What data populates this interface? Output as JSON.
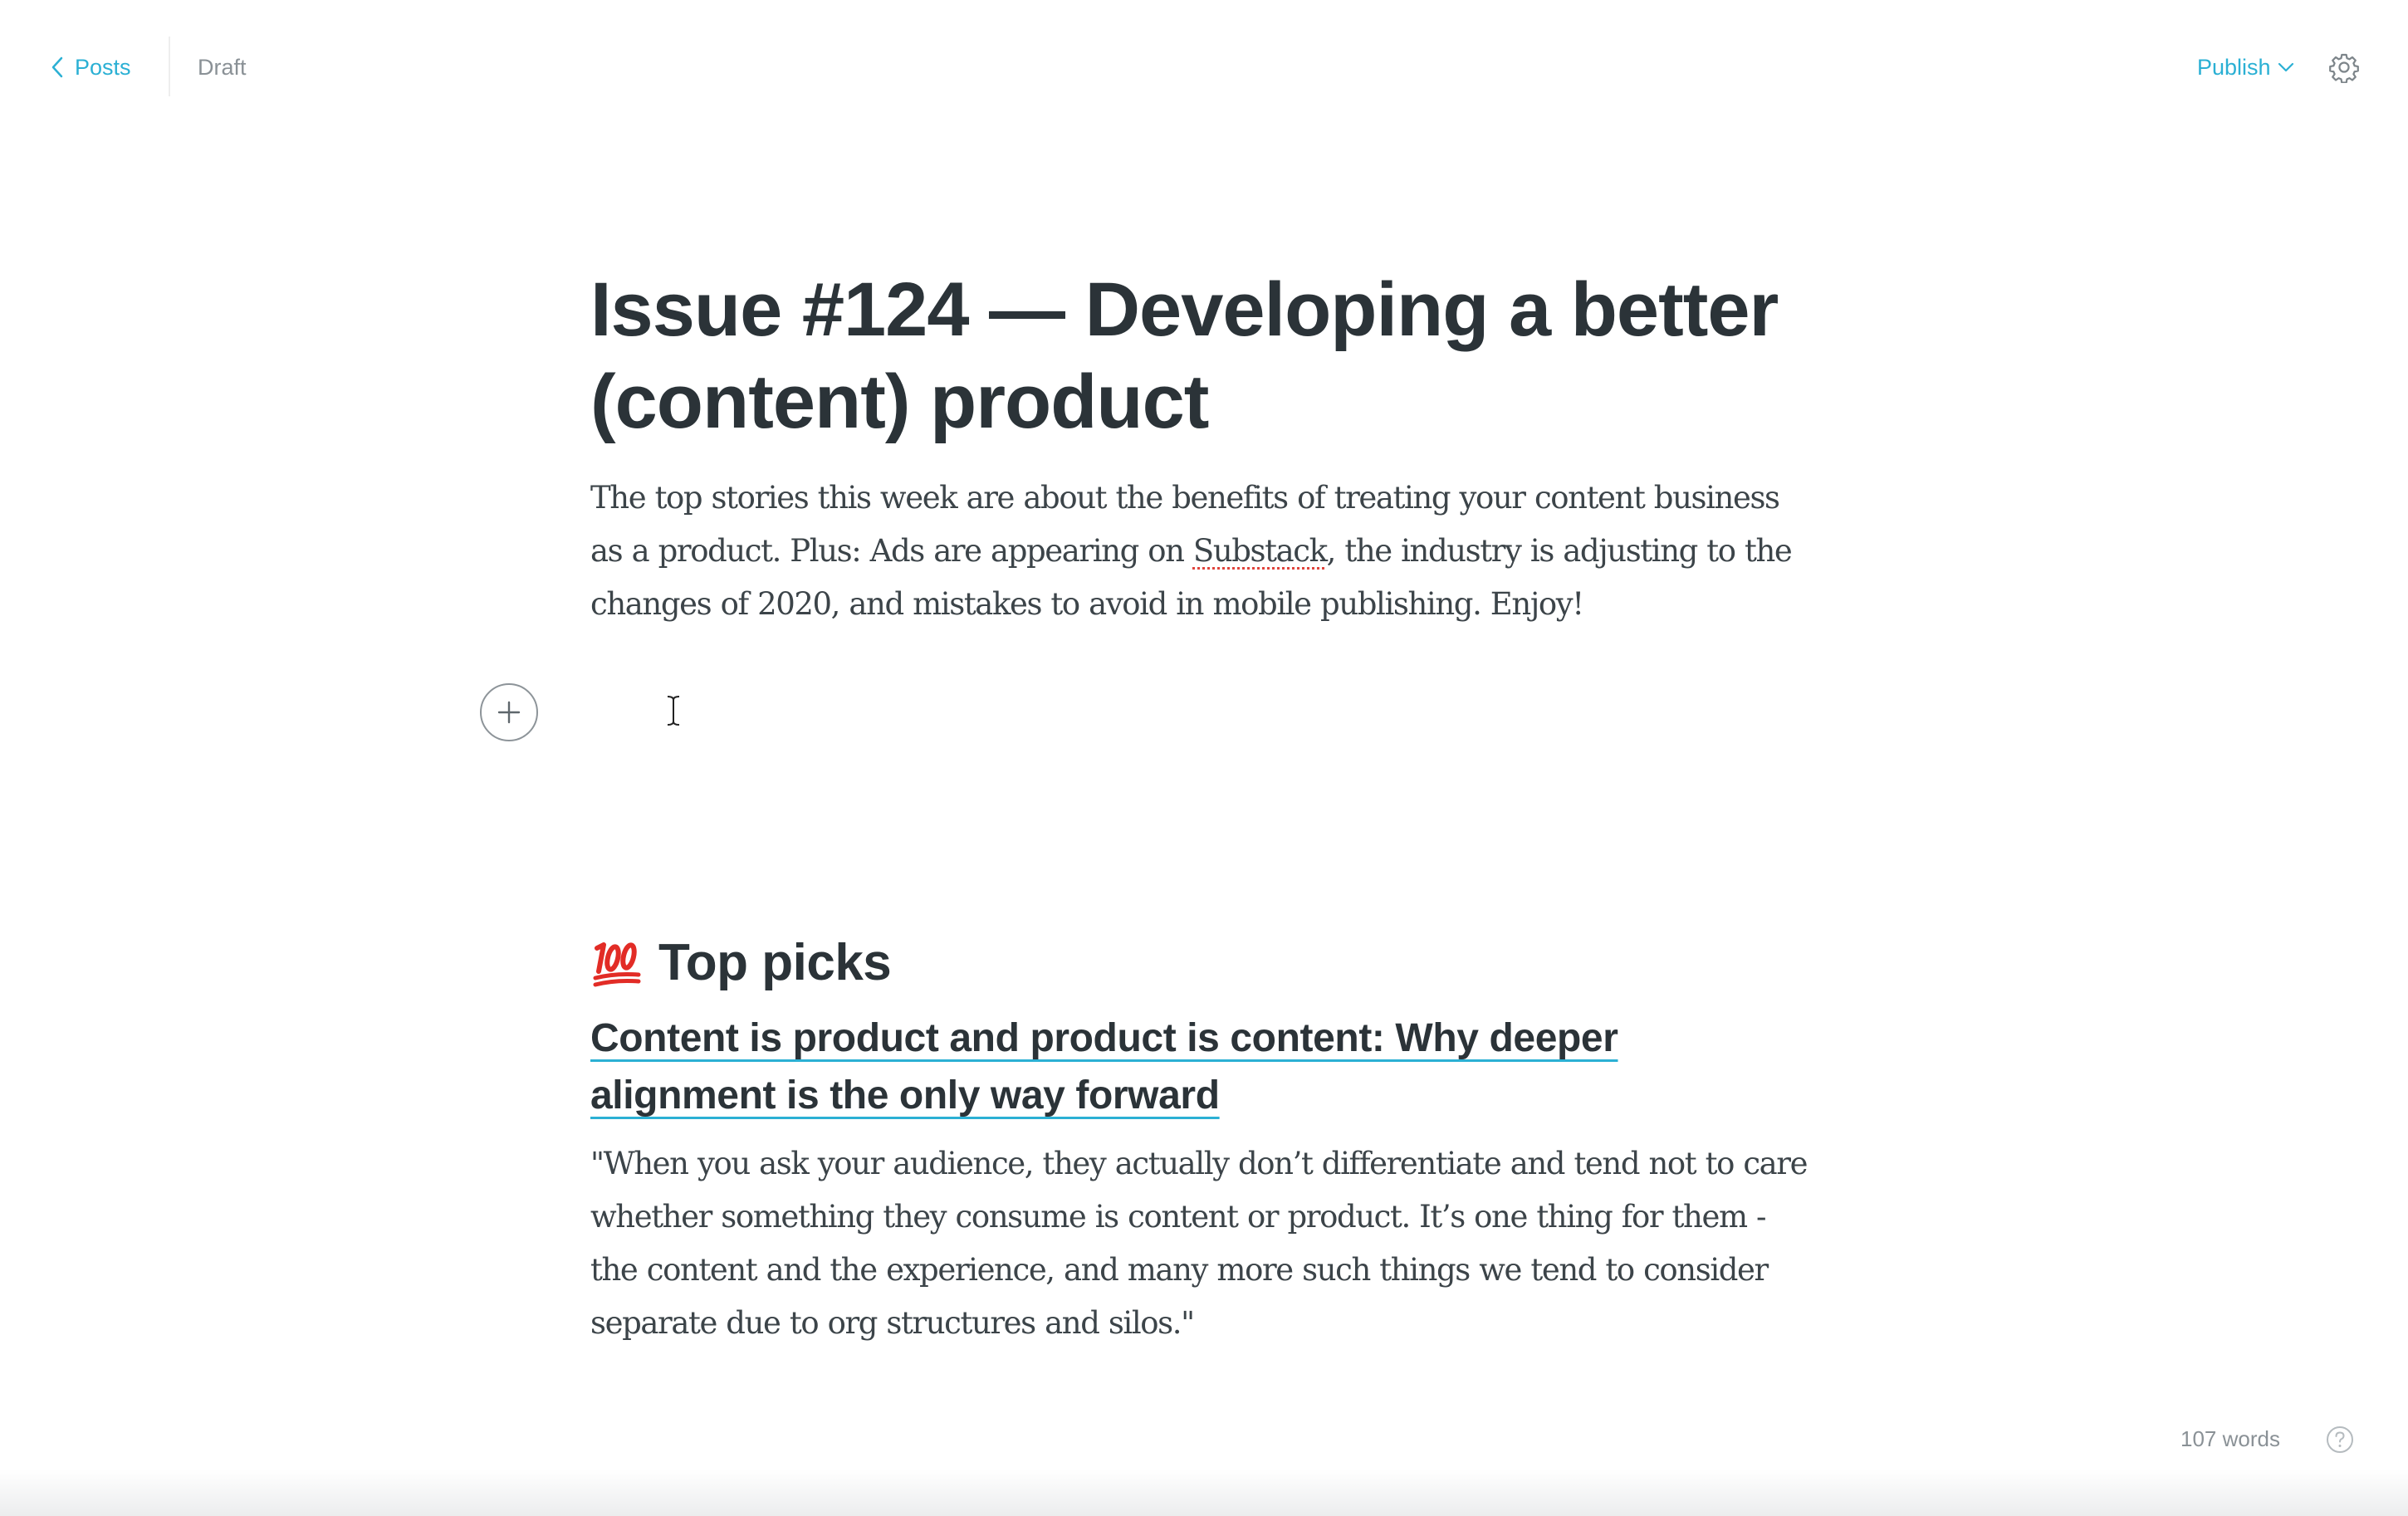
{
  "header": {
    "back_label": "Posts",
    "status_label": "Draft",
    "publish_label": "Publish"
  },
  "post": {
    "title_line1": "Issue #124 — Developing a better",
    "title_line2": "(content) product",
    "subtitle_part1": "The top stories this week are about the benefits of treating your content business as a product. Plus: Ads are appearing on ",
    "subtitle_misspelled": "Substack",
    "subtitle_part2": ", the industry is adjusting to the changes of 2020, and mistakes to avoid in mobile publishing. Enjoy!"
  },
  "section": {
    "heading": "Top picks",
    "heading_emoji": "hundred-points-emoji",
    "article_title_line1": "Content is product and product is content: Why deeper",
    "article_title_line2": "alignment is the only way forward",
    "quote": "\"When you ask your audience, they actually don’t differentiate and tend not to care whether something they consume is content or product. It’s one thing for them - the content and the experience, and many more such things we tend to consider separate due to org structures and silos.\""
  },
  "footer": {
    "word_count": "107 words"
  },
  "colors": {
    "accent": "#2bb0d4",
    "text": "#2b3338",
    "muted": "#8a9196",
    "spellcheck": "#e0443c"
  },
  "icons": {
    "back": "chevron-left-icon",
    "publish_dropdown": "chevron-down-icon",
    "settings": "gear-icon",
    "add_block": "plus-icon",
    "help": "question-circle-icon"
  }
}
